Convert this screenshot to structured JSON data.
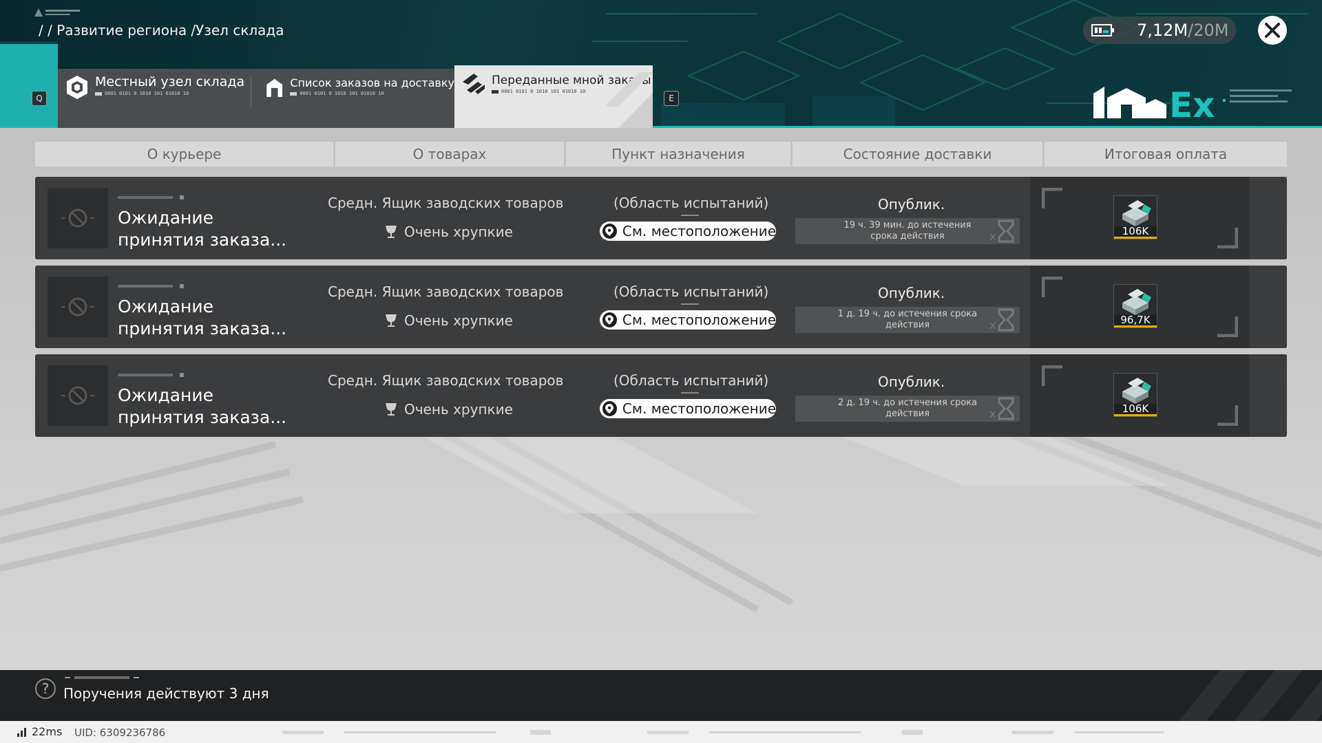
{
  "header": {
    "breadcrumb": [
      "/ / Развитие региона",
      "/Узел склада"
    ],
    "currency": {
      "current": "7,12M",
      "max": "/20M"
    },
    "logo_text": "Ex",
    "tab_key_left": "Q",
    "tab_key_right": "E",
    "tabs": [
      {
        "label": "Местный узел склада",
        "code": "0001 0101 0 1010 101 01010 10",
        "active": false
      },
      {
        "label": "Список заказов на доставку",
        "code": "0001 0101 0 1010 101 01010 10",
        "active": false
      },
      {
        "label": "Переданные мной заказы",
        "code": "0001 0101 0 1010 101 01010 10",
        "active": true
      }
    ]
  },
  "columns": [
    "О курьере",
    "О товарах",
    "Пункт назначения",
    "Состояние доставки",
    "Итоговая оплата"
  ],
  "orders": [
    {
      "courier_status": "Ожидание принятия заказа...",
      "goods_name": "Средн. Ящик заводских товаров",
      "goods_attr": "Очень хрупкие",
      "destination": "(Область испытаний)",
      "location_button": "См. местоположение",
      "status": "Опублик.",
      "expiry": "19 ч. 39 мин. до истечения срока действия",
      "payment": "106K"
    },
    {
      "courier_status": "Ожидание принятия заказа...",
      "goods_name": "Средн. Ящик заводских товаров",
      "goods_attr": "Очень хрупкие",
      "destination": "(Область испытаний)",
      "location_button": "См. местоположение",
      "status": "Опублик.",
      "expiry": "1 д. 19 ч. до истечения срока действия",
      "payment": "96,7K"
    },
    {
      "courier_status": "Ожидание принятия заказа...",
      "goods_name": "Средн. Ящик заводских товаров",
      "goods_attr": "Очень хрупкие",
      "destination": "(Область испытаний)",
      "location_button": "См. местоположение",
      "status": "Опублик.",
      "expiry": "2 д. 19 ч. до истечения срока действия",
      "payment": "106K"
    }
  ],
  "footer": {
    "help_glyph": "?",
    "note": "Поручения действуют 3 дня"
  },
  "statusbar": {
    "ping": "22ms",
    "uid": "UID: 6309236786"
  },
  "colors": {
    "accent": "#1eb8b8",
    "header_bg": "#0c3b3f",
    "row_bg": "#3b3c3e",
    "gold": "#e0b000"
  }
}
